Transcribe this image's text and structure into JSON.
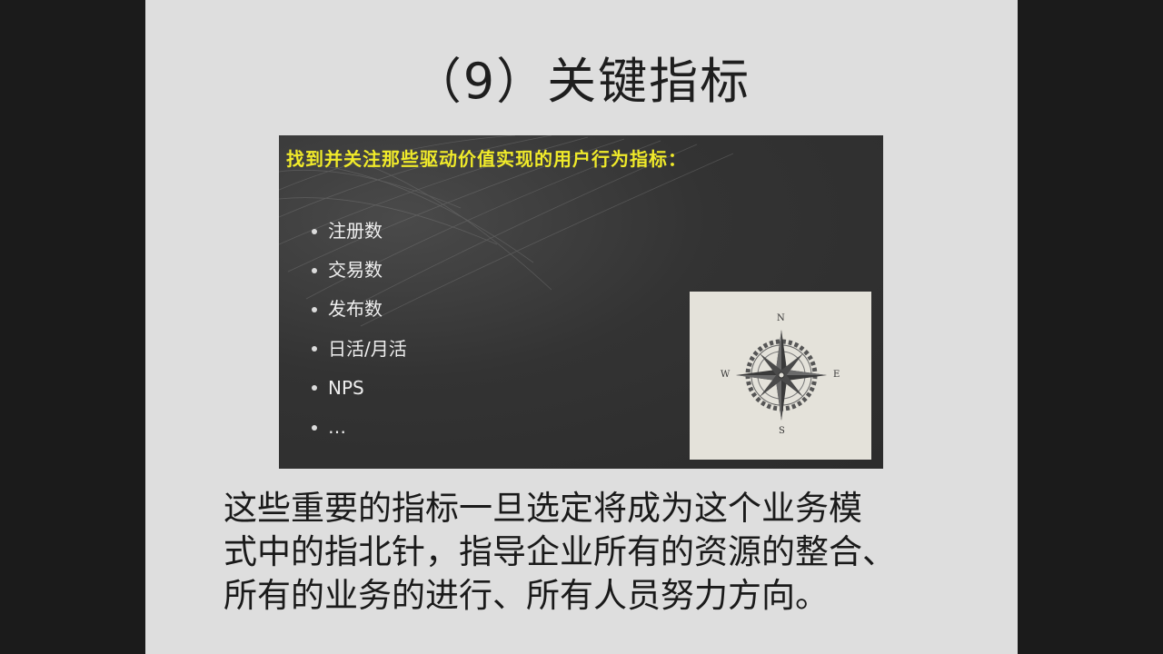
{
  "slide": {
    "title": "（9）关键指标",
    "panel": {
      "heading": "找到并关注那些驱动价值实现的用户行为指标：",
      "bullets": [
        "注册数",
        "交易数",
        "发布数",
        "日活/月活",
        "NPS",
        "…"
      ],
      "heading_color": "#f0ea2a"
    },
    "compass": {
      "icon": "compass-rose-icon",
      "north": "N",
      "east": "E",
      "south": "S",
      "west": "W"
    },
    "body_lines": [
      "这些重要的指标一旦选定将成为这个业务模",
      "式中的指北针，指导企业所有的资源的整合、",
      "所有的业务的进行、所有人员努力方向。"
    ]
  }
}
